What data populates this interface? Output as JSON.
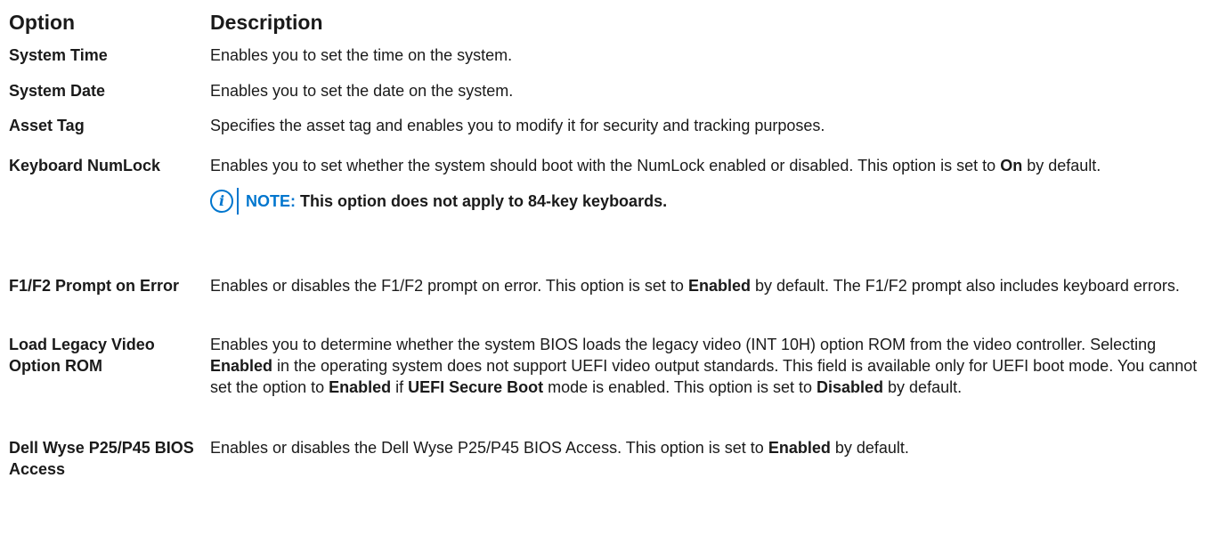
{
  "header": {
    "option": "Option",
    "description": "Description"
  },
  "rows": [
    {
      "option": "System Time",
      "desc": "Enables you to set the time on the system."
    },
    {
      "option": "System Date",
      "desc": "Enables you to set the date on the system."
    },
    {
      "option": "Asset Tag",
      "desc": "Specifies the asset tag and enables you to modify it for security and tracking purposes."
    },
    {
      "option": "Keyboard NumLock",
      "desc_a": "Enables you to set whether the system should boot with the NumLock enabled or disabled. This option is set to ",
      "desc_b": "On",
      "desc_c": " by default.",
      "note_label": "NOTE:",
      "note_text": "This option does not apply to 84-key keyboards."
    },
    {
      "option": "F1/F2 Prompt on Error",
      "desc_a": "Enables or disables the F1/F2 prompt on error. This option is set to ",
      "desc_b": "Enabled",
      "desc_c": " by default. The F1/F2 prompt also includes keyboard errors."
    },
    {
      "option": "Load Legacy Video Option ROM",
      "desc_a": "Enables you to determine whether the system BIOS loads the legacy video (INT 10H) option ROM from the video controller. Selecting ",
      "desc_b": "Enabled",
      "desc_c": " in the operating system does not support UEFI video output standards. This field is available only for UEFI boot mode. You cannot set the option to ",
      "desc_d": "Enabled",
      "desc_e": " if ",
      "desc_f": "UEFI Secure Boot",
      "desc_g": " mode is enabled. This option is set to ",
      "desc_h": "Disabled",
      "desc_i": " by default."
    },
    {
      "option": "Dell Wyse P25/P45 BIOS Access",
      "desc_a": "Enables or disables the Dell Wyse P25/P45 BIOS Access. This option is set to ",
      "desc_b": "Enabled",
      "desc_c": " by default."
    }
  ],
  "icons": {
    "note": "info-icon",
    "note_glyph": "i"
  },
  "colors": {
    "accent": "#0076ce"
  }
}
